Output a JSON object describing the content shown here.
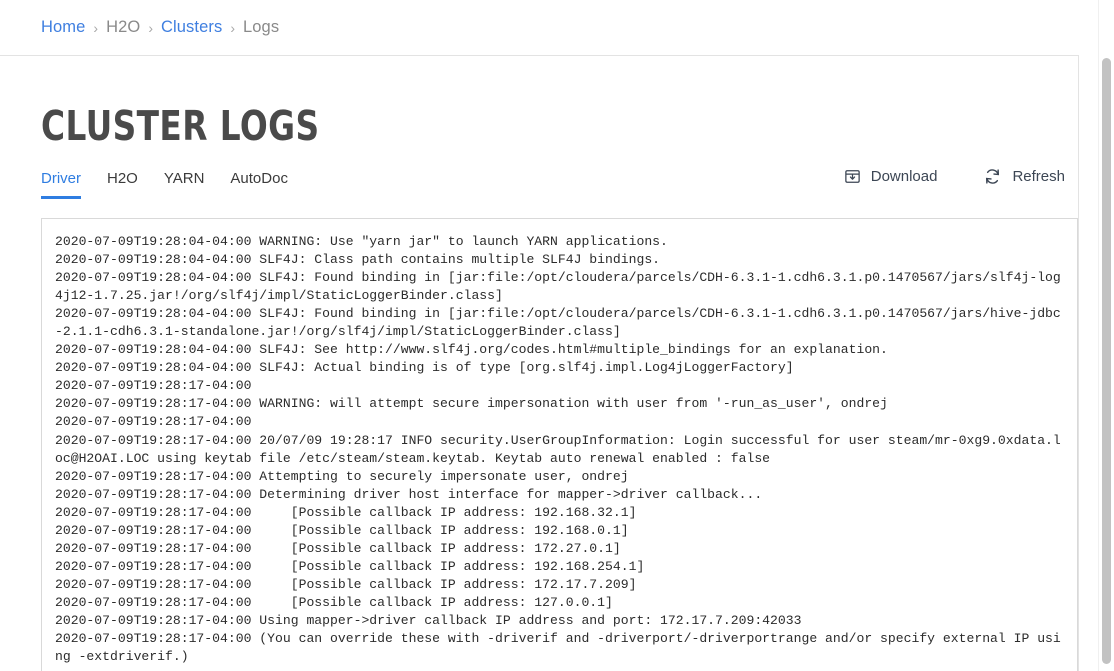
{
  "breadcrumb": {
    "separator": "›",
    "items": [
      {
        "label": "Home",
        "type": "link"
      },
      {
        "label": "H2O",
        "type": "plain"
      },
      {
        "label": "Clusters",
        "type": "link"
      },
      {
        "label": "Logs",
        "type": "plain"
      }
    ]
  },
  "page": {
    "title": "CLUSTER LOGS"
  },
  "tabs": [
    {
      "label": "Driver",
      "active": true
    },
    {
      "label": "H2O",
      "active": false
    },
    {
      "label": "YARN",
      "active": false
    },
    {
      "label": "AutoDoc",
      "active": false
    }
  ],
  "actions": {
    "download_label": "Download",
    "download_icon": "download-box-icon",
    "refresh_label": "Refresh",
    "refresh_icon": "refresh-icon"
  },
  "colors": {
    "link": "#3f7fe0",
    "tab_active": "#2f7de1",
    "title": "#4a4a4a",
    "muted_text": "#8a8a8a",
    "log_text": "#2b2b2b",
    "panel_border": "#d9d9d9",
    "action_text": "#3c4654"
  },
  "log": {
    "lines": [
      "2020-07-09T19:28:04-04:00 WARNING: Use \"yarn jar\" to launch YARN applications.",
      "2020-07-09T19:28:04-04:00 SLF4J: Class path contains multiple SLF4J bindings.",
      "2020-07-09T19:28:04-04:00 SLF4J: Found binding in [jar:file:/opt/cloudera/parcels/CDH-6.3.1-1.cdh6.3.1.p0.1470567/jars/slf4j-log4j12-1.7.25.jar!/org/slf4j/impl/StaticLoggerBinder.class]",
      "2020-07-09T19:28:04-04:00 SLF4J: Found binding in [jar:file:/opt/cloudera/parcels/CDH-6.3.1-1.cdh6.3.1.p0.1470567/jars/hive-jdbc-2.1.1-cdh6.3.1-standalone.jar!/org/slf4j/impl/StaticLoggerBinder.class]",
      "2020-07-09T19:28:04-04:00 SLF4J: See http://www.slf4j.org/codes.html#multiple_bindings for an explanation.",
      "2020-07-09T19:28:04-04:00 SLF4J: Actual binding is of type [org.slf4j.impl.Log4jLoggerFactory]",
      "2020-07-09T19:28:17-04:00 ",
      "2020-07-09T19:28:17-04:00 WARNING: will attempt secure impersonation with user from '-run_as_user', ondrej",
      "2020-07-09T19:28:17-04:00 ",
      "2020-07-09T19:28:17-04:00 20/07/09 19:28:17 INFO security.UserGroupInformation: Login successful for user steam/mr-0xg9.0xdata.loc@H2OAI.LOC using keytab file /etc/steam/steam.keytab. Keytab auto renewal enabled : false",
      "2020-07-09T19:28:17-04:00 Attempting to securely impersonate user, ondrej",
      "2020-07-09T19:28:17-04:00 Determining driver host interface for mapper->driver callback...",
      "2020-07-09T19:28:17-04:00     [Possible callback IP address: 192.168.32.1]",
      "2020-07-09T19:28:17-04:00     [Possible callback IP address: 192.168.0.1]",
      "2020-07-09T19:28:17-04:00     [Possible callback IP address: 172.27.0.1]",
      "2020-07-09T19:28:17-04:00     [Possible callback IP address: 192.168.254.1]",
      "2020-07-09T19:28:17-04:00     [Possible callback IP address: 172.17.7.209]",
      "2020-07-09T19:28:17-04:00     [Possible callback IP address: 127.0.0.1]",
      "2020-07-09T19:28:17-04:00 Using mapper->driver callback IP address and port: 172.17.7.209:42033",
      "2020-07-09T19:28:17-04:00 (You can override these with -driverif and -driverport/-driverportrange and/or specify external IP using -extdriverif.)"
    ]
  }
}
